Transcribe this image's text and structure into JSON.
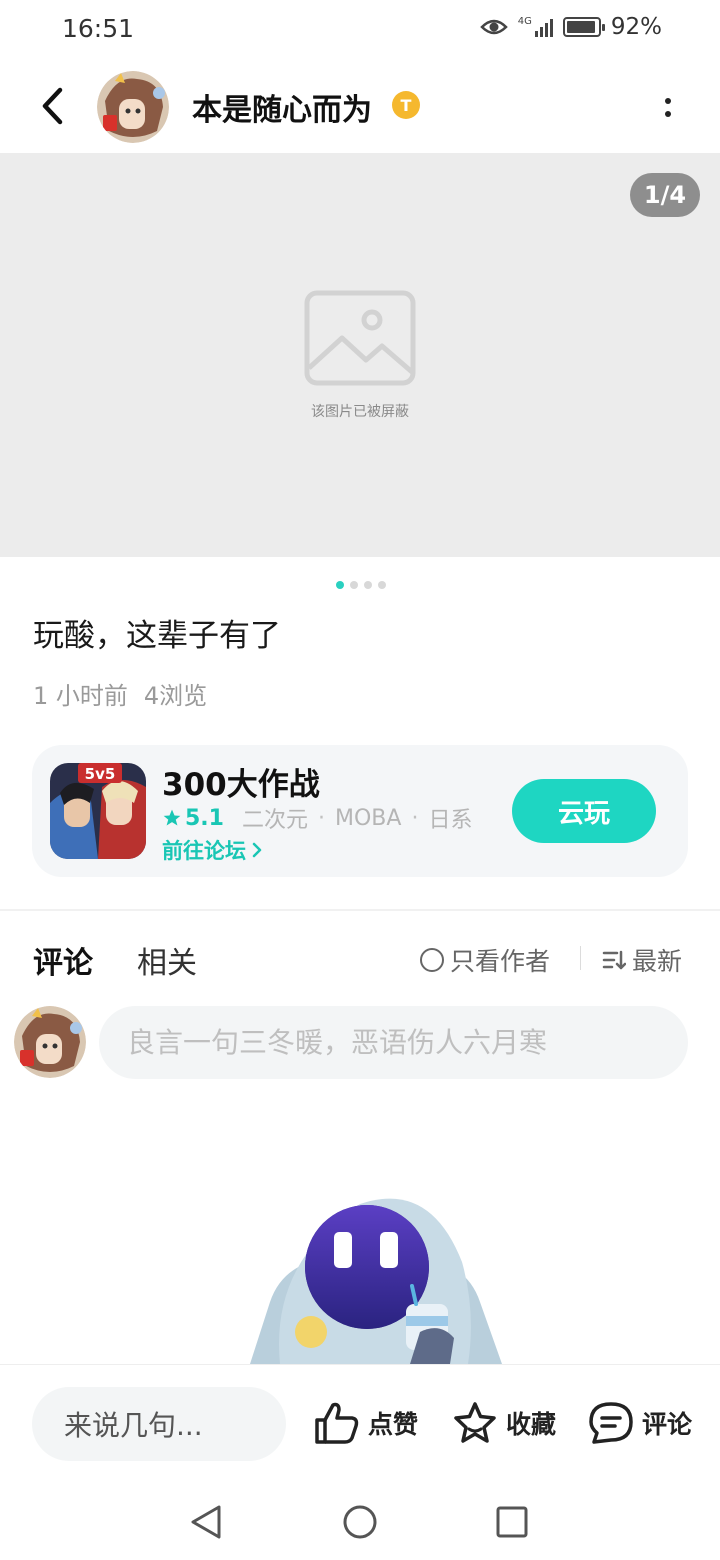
{
  "status_bar": {
    "time": "16:51",
    "battery_percent": "92%",
    "network": "4G"
  },
  "header": {
    "author_name": "本是随心而为",
    "badge_letter": "T"
  },
  "gallery": {
    "counter": "1/4",
    "blocked_text": "该图片已被屏蔽",
    "total_images": 4,
    "current_index": 1
  },
  "post": {
    "title": "玩酸，这辈子有了",
    "time": "1 小时前",
    "views": "4浏览"
  },
  "game_card": {
    "icon_text": "5v5",
    "name": "300大作战",
    "rating": "5.1",
    "tags": [
      "二次元",
      "MOBA",
      "日系"
    ],
    "forum_link": "前往论坛",
    "play_button": "云玩"
  },
  "tabs": {
    "comments": "评论",
    "related": "相关",
    "author_only": "只看作者",
    "sort": "最新"
  },
  "comment_box": {
    "placeholder": "良言一句三冬暖，恶语伤人六月寒"
  },
  "bottom_bar": {
    "input_placeholder": "来说几句...",
    "like": "点赞",
    "favorite": "收藏",
    "comment": "评论"
  },
  "colors": {
    "accent": "#1ed6c2",
    "accent_text": "#19c6b4",
    "badge": "#f5b82e"
  }
}
